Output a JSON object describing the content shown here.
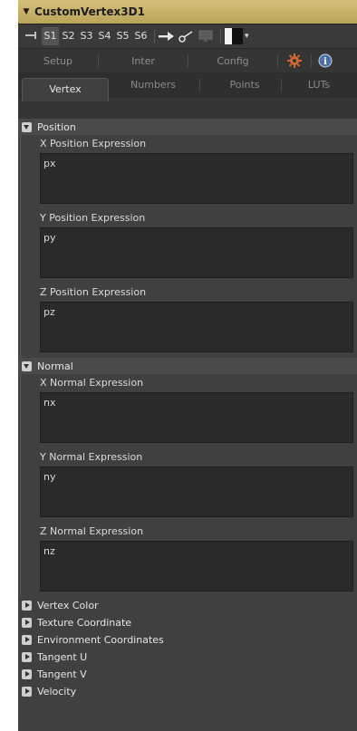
{
  "title": "CustomVertex3D1",
  "toolbar": {
    "slots": [
      "S1",
      "S2",
      "S3",
      "S4",
      "S5",
      "S6"
    ],
    "active_slot": "S1"
  },
  "tabs_row1": [
    "Setup",
    "Inter",
    "Config"
  ],
  "tabs_row2": [
    "Vertex",
    "Numbers",
    "Points",
    "LUTs"
  ],
  "active_tab": "Vertex",
  "sections": {
    "position": {
      "label": "Position",
      "fields": [
        {
          "label": "X Position Expression",
          "value": "px"
        },
        {
          "label": "Y Position Expression",
          "value": "py"
        },
        {
          "label": "Z Position Expression",
          "value": "pz"
        }
      ]
    },
    "normal": {
      "label": "Normal",
      "fields": [
        {
          "label": "X Normal Expression",
          "value": "nx"
        },
        {
          "label": "Y Normal Expression",
          "value": "ny"
        },
        {
          "label": "Z Normal Expression",
          "value": "nz"
        }
      ]
    },
    "collapsed": [
      "Vertex Color",
      "Texture Coordinate",
      "Environment Coordinates",
      "Tangent U",
      "Tangent V",
      "Velocity"
    ]
  },
  "colors": {
    "header_gold": "#c9b46a",
    "panel_bg": "#404040",
    "field_bg": "#2a2a2a",
    "gear_orange": "#d4692d",
    "info_blue": "#4a6fa3"
  },
  "icons": [
    "collapse-triangle-icon",
    "pin-icon",
    "arrow-right-icon",
    "link-icon",
    "monitor-icon",
    "color-swatch-icon",
    "gear-icon",
    "info-icon",
    "disclosure-triangle-icon"
  ]
}
